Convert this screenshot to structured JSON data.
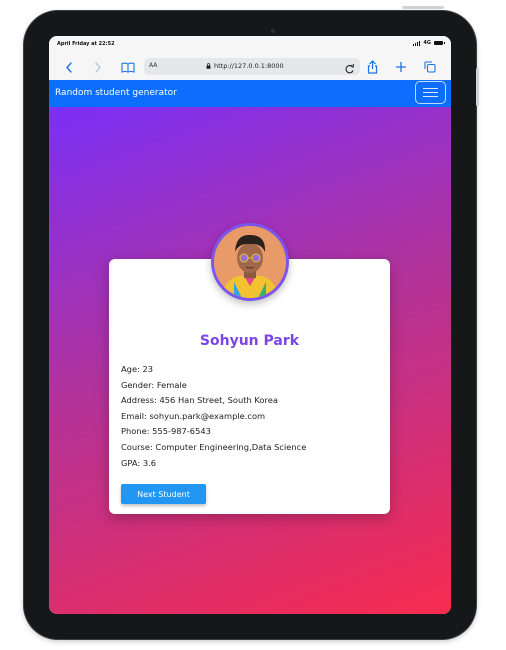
{
  "status_bar": {
    "time": "April Friday at 22:52",
    "network": "4G"
  },
  "browser": {
    "text_size_label": "AA",
    "url": "http://127.0.0.1:8000",
    "icons": [
      "back-icon",
      "forward-icon",
      "bookmarks-icon",
      "lock-icon",
      "reload-icon",
      "share-icon",
      "new-tab-icon",
      "tabs-icon"
    ]
  },
  "navbar": {
    "brand": "Random student generator",
    "toggler_icon": "hamburger-menu-icon"
  },
  "student": {
    "name": "Sohyun Park",
    "age": "Age: 23",
    "gender": "Gender: Female",
    "address": "Address: 456 Han Street, South Korea",
    "email": "Email: sohyun.park@example.com",
    "phone": "Phone: 555-987-6543",
    "course": "Course: Computer Engineering,Data Science",
    "gpa": "GPA: 3.6",
    "avatar_icon": "student-avatar"
  },
  "actions": {
    "next_label": "Next Student"
  },
  "colors": {
    "navbar": "#0d6efd",
    "gradient_start": "#7b2ff7",
    "gradient_end": "#f72b4f",
    "name_color": "#7b46e6",
    "button": "#2196f3"
  }
}
